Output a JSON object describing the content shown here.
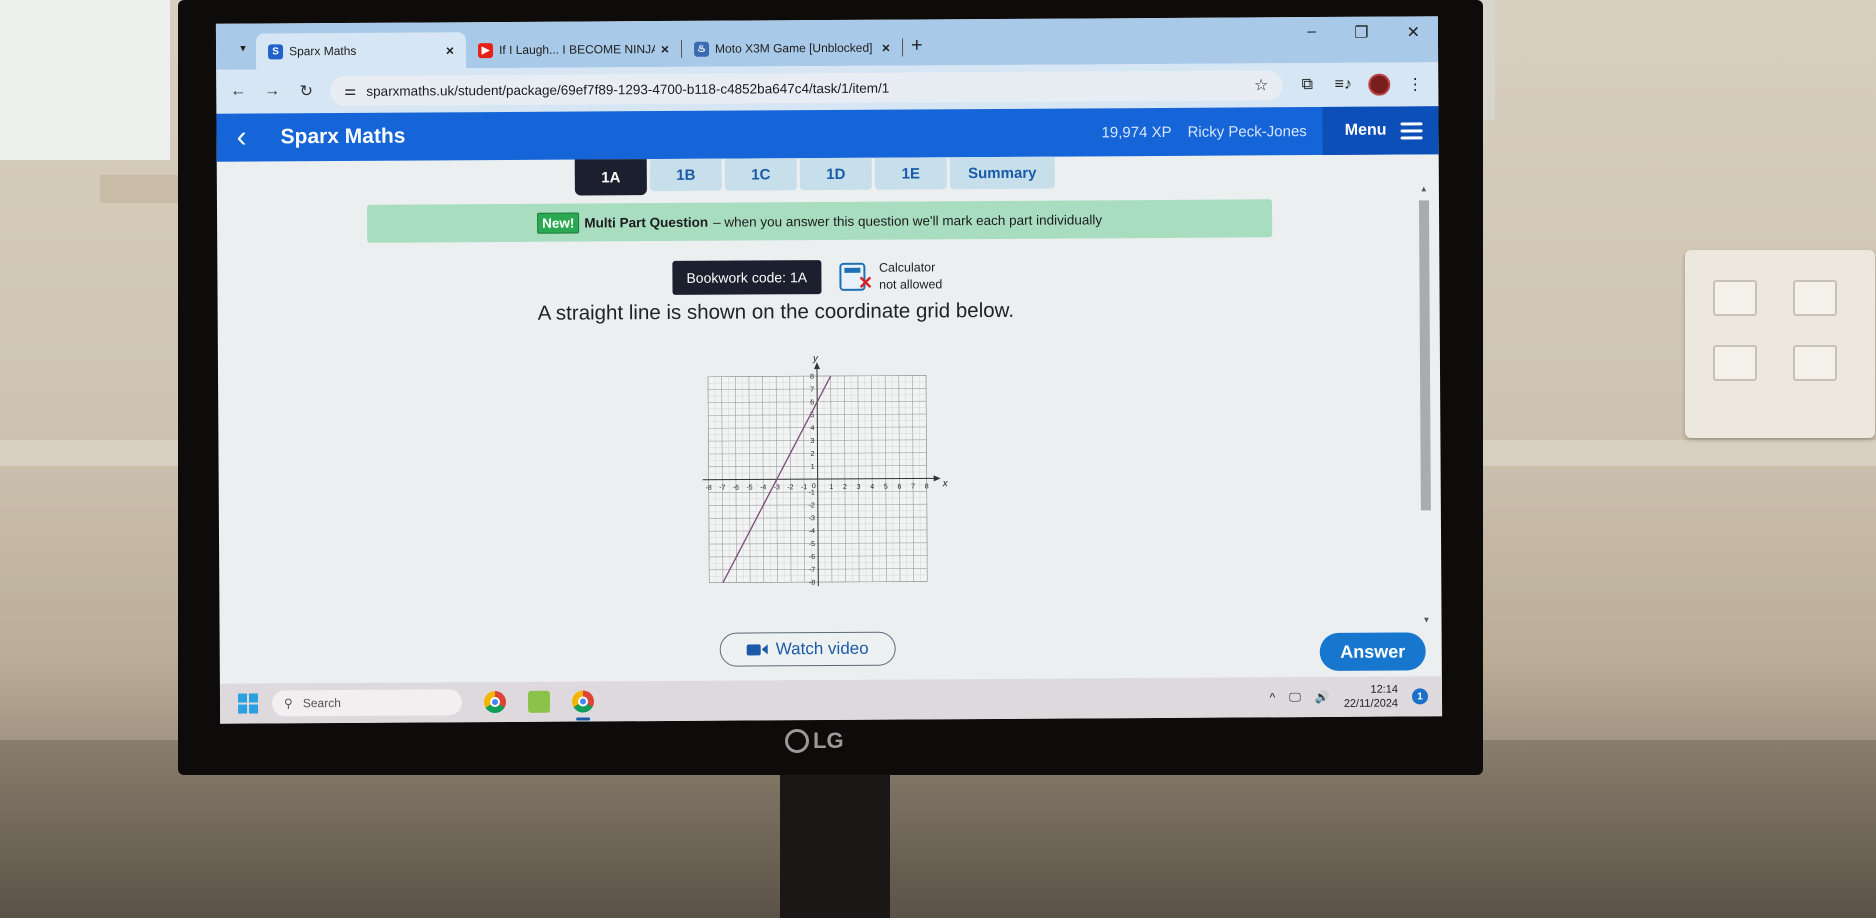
{
  "browser": {
    "tabs": [
      {
        "title": "Sparx Maths",
        "favicon": "S",
        "active": true
      },
      {
        "title": "If I Laugh... I BECOME NINJA - Y",
        "favicon": "youtube",
        "active": false
      },
      {
        "title": "Moto X3M Game [Unblocked] |",
        "favicon": "game",
        "active": false
      }
    ],
    "url": "sparxmaths.uk/student/package/69ef7f89-1293-4700-b118-c4852ba647c4/task/1/item/1",
    "window_controls": {
      "minimize": "–",
      "restore": "❐",
      "close": "✕"
    },
    "new_tab": "+"
  },
  "header": {
    "back": "‹",
    "brand": "Sparx Maths",
    "xp": "19,974 XP",
    "user": "Ricky Peck-Jones",
    "menu": "Menu"
  },
  "part_tabs": [
    {
      "label": "1A",
      "active": true
    },
    {
      "label": "1B",
      "active": false
    },
    {
      "label": "1C",
      "active": false
    },
    {
      "label": "1D",
      "active": false
    },
    {
      "label": "1E",
      "active": false
    },
    {
      "label": "Summary",
      "active": false
    }
  ],
  "banner": {
    "badge": "New!",
    "title": "Multi Part Question",
    "text": "– when you answer this question we'll mark each part individually"
  },
  "bookwork": {
    "code": "Bookwork code: 1A",
    "calculator_line1": "Calculator",
    "calculator_line2": "not allowed"
  },
  "question": "A straight line is shown on the coordinate grid below.",
  "chart_data": {
    "type": "line",
    "title": "",
    "xlabel": "x",
    "ylabel": "y",
    "xlim": [
      -8,
      8
    ],
    "ylim": [
      -8,
      8
    ],
    "grid": true,
    "x_ticks": [
      -8,
      -7,
      -6,
      -5,
      -4,
      -3,
      -2,
      -1,
      1,
      2,
      3,
      4,
      5,
      6,
      7,
      8
    ],
    "y_ticks": [
      -8,
      -7,
      -6,
      -5,
      -4,
      -3,
      -2,
      -1,
      1,
      2,
      3,
      4,
      5,
      6,
      7,
      8
    ],
    "origin_label": "0",
    "series": [
      {
        "name": "line",
        "x": [
          -7,
          1
        ],
        "y": [
          -8,
          8
        ],
        "color": "#7a4a7a"
      }
    ]
  },
  "actions": {
    "watch_video": "Watch video",
    "answer": "Answer"
  },
  "taskbar": {
    "search_placeholder": "Search",
    "time": "12:14",
    "date": "22/11/2024",
    "notifications": "1"
  },
  "monitor_brand": "LG"
}
